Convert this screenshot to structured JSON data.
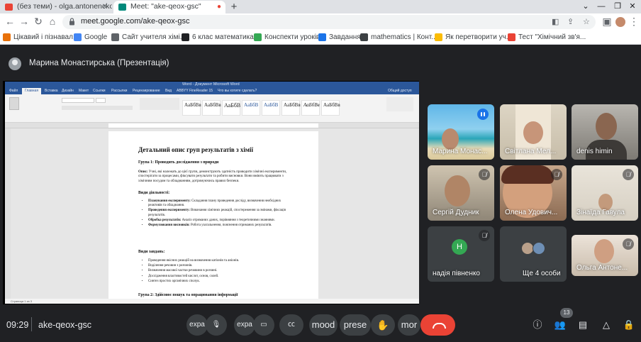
{
  "browser": {
    "tabs": [
      {
        "label": "(без теми) - olga.antonencko@gm...",
        "active": false
      },
      {
        "label": "Meet: \"ake-qeox-gsc\"",
        "active": true
      }
    ],
    "url": "meet.google.com/ake-qeox-gsc",
    "bookmarks": [
      {
        "label": "Цікавий і пізнавал...",
        "color": "#e8710a"
      },
      {
        "label": "Google",
        "color": "#4285f4"
      },
      {
        "label": "Сайт учителя хімі...",
        "color": "#5f6368"
      },
      {
        "label": "6 клас математика...",
        "color": "#202124"
      },
      {
        "label": "Конспекти уроків",
        "color": "#34a853"
      },
      {
        "label": "Завдання",
        "color": "#1a73e8"
      },
      {
        "label": "mathematics | Конт...",
        "color": "#3c4043"
      },
      {
        "label": "Як перетворити уч...",
        "color": "#fbbc04"
      },
      {
        "label": "Тест \"Хімічний зв'я...",
        "color": "#ea4335"
      }
    ]
  },
  "meet": {
    "presenter_label": "Марина Монастирська (Презентація)",
    "time": "09:29",
    "meeting_code": "ake-qeox-gsc",
    "participants_badge": "13",
    "controls": {
      "expand1": "expa",
      "expand2": "expa",
      "mood": "mood",
      "present": "prese",
      "more": "mor"
    },
    "tiles": [
      {
        "name": "Марина Монас...",
        "state": "speaking"
      },
      {
        "name": "Світлана Мел...",
        "state": "video"
      },
      {
        "name": "denis himin",
        "state": "video"
      },
      {
        "name": "Сергій Дудник",
        "state": "muted"
      },
      {
        "name": "Олена Удович...",
        "state": "muted"
      },
      {
        "name": "Зінаїда Гавула",
        "state": "muted"
      },
      {
        "name": "надія півненко",
        "initial": "Н",
        "state": "muted"
      },
      {
        "name": "Ще 4 особи",
        "state": "group"
      },
      {
        "name": "Ольга Антоне...",
        "state": "muted"
      }
    ]
  },
  "document": {
    "window_title": "Word - Документ Microsoft Word",
    "menu": [
      "Файл",
      "Главная",
      "Вставка",
      "Дизайн",
      "Макет",
      "Ссылки",
      "Рассылки",
      "Рецензирование",
      "Вид",
      "ABBYY FineReader 15",
      "Что вы хотите сделать?",
      "Общий доступ"
    ],
    "styles": [
      "АаБбВв",
      "АаБбВв",
      "АаБбВ",
      "АаБбВ",
      "АаБбВ",
      "АаБбВв",
      "АаБбВв",
      "АаБбВв"
    ],
    "title": "Детальний опис груп результатів з хімії",
    "group1_heading": "Група 1: Проводить дослідження з природи",
    "description_label": "Опис:",
    "description": "Учні, які належать до цієї групи, демонструють здатність проводити хімічні експерименти, спостерігати за процесами, фіксувати результати та робити висновки. Вони вміють працювати з хімічним посудом та обладнанням, дотримуючись правил безпеки.",
    "activities_heading": "Види діяльності:",
    "activities": [
      {
        "label": "Планування експерименту:",
        "text": "Складання плану проведення досліду, визначення необхідних реактивів та обладнання."
      },
      {
        "label": "Проведення експерименту:",
        "text": "Виконання хімічних реакцій, спостереження за змінами, фіксація результатів."
      },
      {
        "label": "Обробка результатів:",
        "text": "Аналіз отриманих даних, порівняння з теоретичними знаннями."
      },
      {
        "label": "Формулювання висновків:",
        "text": "Робота узагальнення, пояснення отриманих результатів."
      }
    ],
    "tasks_heading": "Види завдань:",
    "tasks": [
      "Проведення якісних реакцій на визначення катіонів та аніонів.",
      "Виділення речовин з розчинів.",
      "Визначення масової частки речовини в розчині.",
      "Дослідження властивостей кислот, основ, солей.",
      "Синтез простих органічних сполук."
    ],
    "group2_heading": "Група 2: Здійснює пошук та опрацювання інформації",
    "status": "Страница 1 из 3"
  }
}
